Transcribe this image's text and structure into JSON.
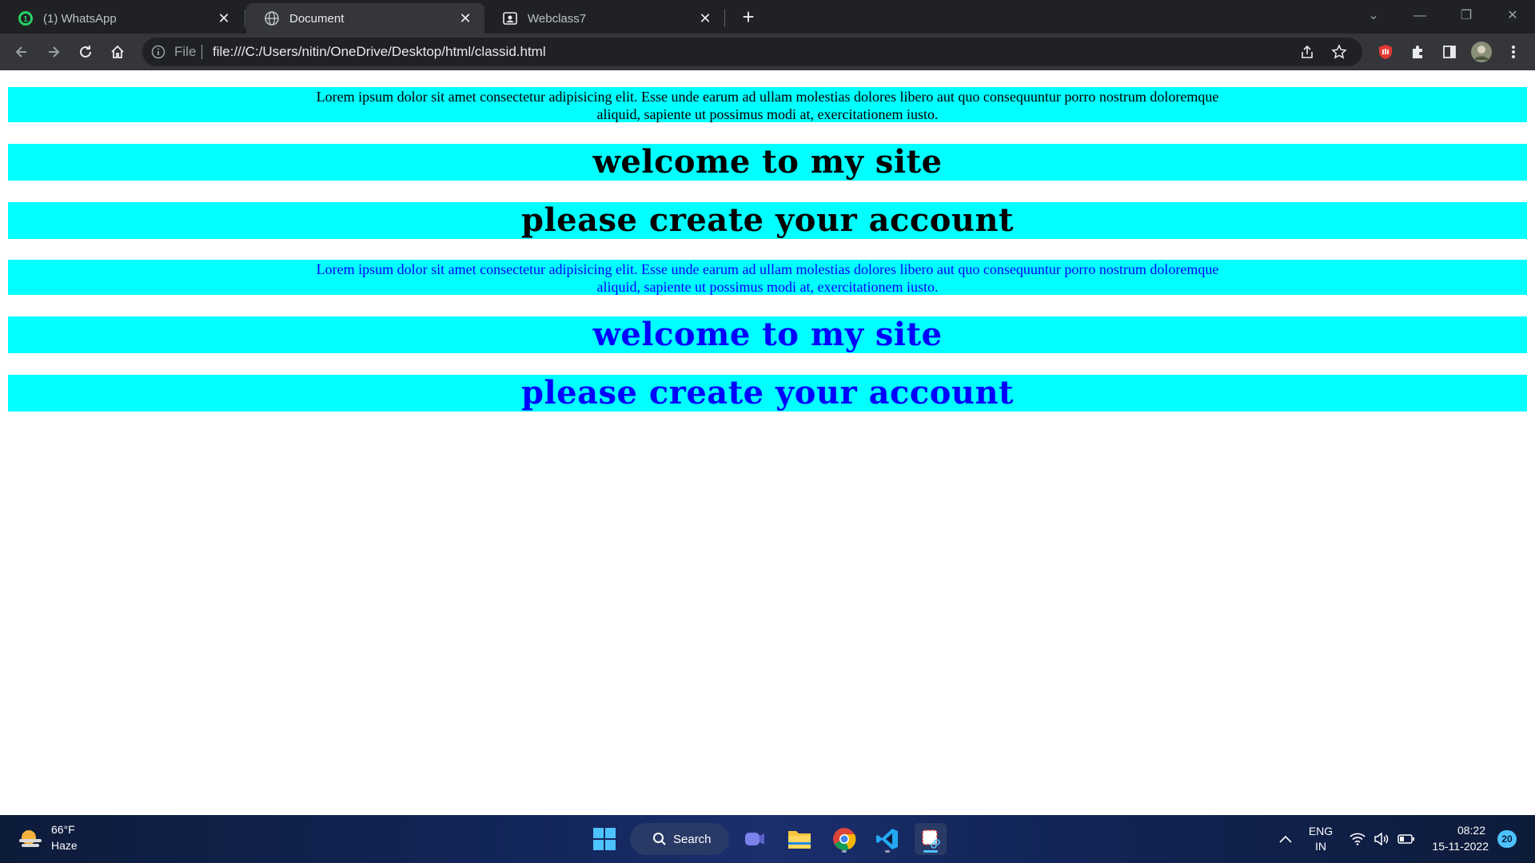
{
  "browser": {
    "tabs": [
      {
        "title": "(1) WhatsApp",
        "icon": "whatsapp-icon",
        "active": false
      },
      {
        "title": "Document",
        "icon": "globe-icon",
        "active": true
      },
      {
        "title": "Webclass7",
        "icon": "contact-card-icon",
        "active": false
      }
    ],
    "address": {
      "scheme_label": "File",
      "url": "file:///C:/Users/nitin/OneDrive/Desktop/html/classid.html"
    }
  },
  "page": {
    "blocks": [
      {
        "kind": "paragraph",
        "text": "Lorem ipsum dolor sit amet consectetur adipisicing elit. Esse unde earum ad ullam molestias dolores libero aut quo consequuntur porro nostrum doloremque aliquid, sapiente ut possimus modi at, exercitationem iusto.",
        "color": "#000000"
      },
      {
        "kind": "heading",
        "text": "welcome to my site",
        "color": "#000000"
      },
      {
        "kind": "heading",
        "text": "please create your account",
        "color": "#000000"
      },
      {
        "kind": "paragraph",
        "text": "Lorem ipsum dolor sit amet consectetur adipisicing elit. Esse unde earum ad ullam molestias dolores libero aut quo consequuntur porro nostrum doloremque aliquid, sapiente ut possimus modi at, exercitationem iusto.",
        "color": "#0000ff"
      },
      {
        "kind": "heading",
        "text": "welcome to my site",
        "color": "#0000ff"
      },
      {
        "kind": "heading",
        "text": "please create your account",
        "color": "#0000ff"
      }
    ],
    "block_background": "#00ffff"
  },
  "taskbar": {
    "weather": {
      "temp": "66°F",
      "condition": "Haze"
    },
    "search_label": "Search",
    "tray": {
      "language": "ENG",
      "region": "IN",
      "time": "08:22",
      "date": "15-11-2022",
      "notifications": "20"
    }
  }
}
